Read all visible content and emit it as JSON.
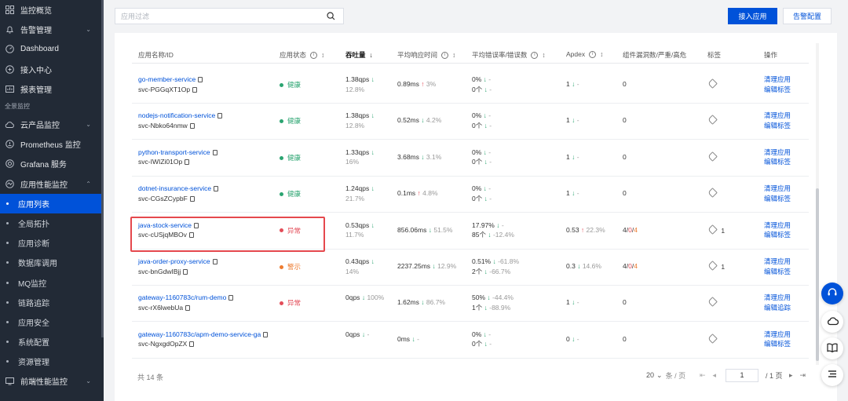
{
  "sidebar": {
    "items": [
      {
        "label": "监控概览",
        "icon": "grid-icon"
      },
      {
        "label": "告警管理",
        "icon": "bell-icon",
        "chevron": "⌄"
      },
      {
        "label": "Dashboard",
        "icon": "dashboard-icon"
      },
      {
        "label": "接入中心",
        "icon": "plug-icon"
      },
      {
        "label": "报表管理",
        "icon": "report-icon"
      }
    ],
    "section_label": "全景监控",
    "items2": [
      {
        "label": "云产品监控",
        "icon": "cloud-icon",
        "chevron": "⌄"
      },
      {
        "label": "Prometheus 监控",
        "icon": "prometheus-icon"
      },
      {
        "label": "Grafana 服务",
        "icon": "grafana-icon"
      },
      {
        "label": "应用性能监控",
        "icon": "apm-icon",
        "chevron": "⌃"
      }
    ],
    "sub_items": [
      "应用列表",
      "全局拓扑",
      "应用诊断",
      "数据库调用",
      "MQ监控",
      "链路追踪",
      "应用安全",
      "系统配置",
      "资源管理"
    ],
    "last_item": {
      "label": "前端性能监控",
      "icon": "frontend-icon",
      "chevron": "⌄"
    }
  },
  "search": {
    "placeholder": "应用过滤"
  },
  "buttons": {
    "primary": "接入应用",
    "secondary": "告警配置"
  },
  "table": {
    "headers": {
      "name": "应用名称/ID",
      "status": "应用状态",
      "throughput": "吞吐量",
      "latency": "平均响应时间",
      "error": "平均错误率/错误数",
      "apdex": "Apdex",
      "vuln": "组件漏洞数/严重/高危",
      "tags": "标签",
      "ops": "操作"
    },
    "rows": [
      {
        "name": "go-member-service",
        "id": "svc-PGGqXT1Op",
        "status": "健康",
        "status_kind": "green",
        "qps": "1.38qps",
        "qps_trend": "↓",
        "qps_pct": "12.8%",
        "latency": "0.89ms",
        "lat_trend": "↑",
        "lat_pct": "3%",
        "err_rate": "0%",
        "err_rate_trend": "↓",
        "err_rate_pct": "-",
        "err_cnt": "0个",
        "err_cnt_trend": "↓",
        "err_cnt_pct": "-",
        "apdex": "1",
        "apdex_trend": "↓",
        "apdex_pct": "-",
        "vuln_a": "0",
        "vuln_b": "",
        "vuln_c": "",
        "tag_count": "",
        "op1": "清理应用",
        "op2": "编辑标签"
      },
      {
        "name": "nodejs-notification-service",
        "id": "svc-Nbko64nmw",
        "status": "健康",
        "status_kind": "green",
        "qps": "1.38qps",
        "qps_trend": "↓",
        "qps_pct": "12.8%",
        "latency": "0.52ms",
        "lat_trend": "↓",
        "lat_pct": "4.2%",
        "err_rate": "0%",
        "err_rate_trend": "↓",
        "err_rate_pct": "-",
        "err_cnt": "0个",
        "err_cnt_trend": "↓",
        "err_cnt_pct": "-",
        "apdex": "1",
        "apdex_trend": "↓",
        "apdex_pct": "-",
        "vuln_a": "0",
        "vuln_b": "",
        "vuln_c": "",
        "tag_count": "",
        "op1": "清理应用",
        "op2": "编辑标签"
      },
      {
        "name": "python-transport-service",
        "id": "svc-IWIZi01Op",
        "status": "健康",
        "status_kind": "green",
        "qps": "1.33qps",
        "qps_trend": "↓",
        "qps_pct": "16%",
        "latency": "3.68ms",
        "lat_trend": "↓",
        "lat_pct": "3.1%",
        "err_rate": "0%",
        "err_rate_trend": "↓",
        "err_rate_pct": "-",
        "err_cnt": "0个",
        "err_cnt_trend": "↓",
        "err_cnt_pct": "-",
        "apdex": "1",
        "apdex_trend": "↓",
        "apdex_pct": "-",
        "vuln_a": "0",
        "vuln_b": "",
        "vuln_c": "",
        "tag_count": "",
        "op1": "清理应用",
        "op2": "编辑标签"
      },
      {
        "name": "dotnet-insurance-service",
        "id": "svc-CGsZCypbF",
        "status": "健康",
        "status_kind": "green",
        "qps": "1.24qps",
        "qps_trend": "↓",
        "qps_pct": "21.7%",
        "latency": "0.1ms",
        "lat_trend": "↑",
        "lat_pct": "4.8%",
        "err_rate": "0%",
        "err_rate_trend": "↓",
        "err_rate_pct": "-",
        "err_cnt": "0个",
        "err_cnt_trend": "↓",
        "err_cnt_pct": "-",
        "apdex": "1",
        "apdex_trend": "↓",
        "apdex_pct": "-",
        "vuln_a": "0",
        "vuln_b": "",
        "vuln_c": "",
        "tag_count": "",
        "op1": "清理应用",
        "op2": "编辑标签"
      },
      {
        "name": "java-stock-service",
        "id": "svc-cUSjqMBOv",
        "status": "异常",
        "status_kind": "red",
        "qps": "0.53qps",
        "qps_trend": "↓",
        "qps_pct": "11.7%",
        "latency": "856.06ms",
        "lat_trend": "↓",
        "lat_pct": "51.5%",
        "err_rate": "17.97%",
        "err_rate_trend": "↓",
        "err_rate_pct": "-",
        "err_cnt": "85个",
        "err_cnt_trend": "↓",
        "err_cnt_pct": "-12.4%",
        "apdex": "0.53",
        "apdex_trend": "↑",
        "apdex_pct": "22.3%",
        "vuln_a": "4",
        "vuln_b": "0",
        "vuln_c": "4",
        "tag_count": "1",
        "op1": "清理应用",
        "op2": "编辑标签"
      },
      {
        "name": "java-order-proxy-service",
        "id": "svc-bnGdwIBjj",
        "status": "警示",
        "status_kind": "orange",
        "qps": "0.43qps",
        "qps_trend": "↓",
        "qps_pct": "14%",
        "latency": "2237.25ms",
        "lat_trend": "↓",
        "lat_pct": "12.9%",
        "err_rate": "0.51%",
        "err_rate_trend": "↓",
        "err_rate_pct": "-61.8%",
        "err_cnt": "2个",
        "err_cnt_trend": "↓",
        "err_cnt_pct": "-66.7%",
        "apdex": "0.3",
        "apdex_trend": "↓",
        "apdex_pct": "14.6%",
        "vuln_a": "4",
        "vuln_b": "0",
        "vuln_c": "4",
        "tag_count": "1",
        "op1": "清理应用",
        "op2": "编辑标签"
      },
      {
        "name": "gateway-1160783c/rum-demo",
        "id": "svc-rX6lwebUa",
        "status": "异常",
        "status_kind": "red",
        "qps": "0qps",
        "qps_trend": "↓",
        "qps_pct": "100%",
        "latency": "1.62ms",
        "lat_trend": "↓",
        "lat_pct": "86.7%",
        "err_rate": "50%",
        "err_rate_trend": "↓",
        "err_rate_pct": "-44.4%",
        "err_cnt": "1个",
        "err_cnt_trend": "↓",
        "err_cnt_pct": "-88.9%",
        "apdex": "1",
        "apdex_trend": "↓",
        "apdex_pct": "-",
        "vuln_a": "0",
        "vuln_b": "",
        "vuln_c": "",
        "tag_count": "",
        "op1": "清理应用",
        "op2": "编辑追踪"
      },
      {
        "name": "gateway-1160783c/apm-demo-service-ga",
        "id": "svc-NgxgdOpZX",
        "status": "",
        "status_kind": "none",
        "qps": "0qps",
        "qps_trend": "↓",
        "qps_pct": "-",
        "latency": "0ms",
        "lat_trend": "↓",
        "lat_pct": "-",
        "err_rate": "0%",
        "err_rate_trend": "↓",
        "err_rate_pct": "-",
        "err_cnt": "0个",
        "err_cnt_trend": "↓",
        "err_cnt_pct": "-",
        "apdex": "0",
        "apdex_trend": "↓",
        "apdex_pct": "-",
        "vuln_a": "0",
        "vuln_b": "",
        "vuln_c": "",
        "tag_count": "",
        "op1": "清理应用",
        "op2": "编辑标签"
      }
    ]
  },
  "footer": {
    "total": "共 14 条",
    "page_size": "20",
    "page_size_unit": "条 / 页",
    "page_current": "1",
    "page_total": "/ 1 页"
  },
  "colors": {
    "primary": "#0052d9",
    "healthy": "#2ba471",
    "error": "#e34d59",
    "warning": "#ed7b2f"
  }
}
